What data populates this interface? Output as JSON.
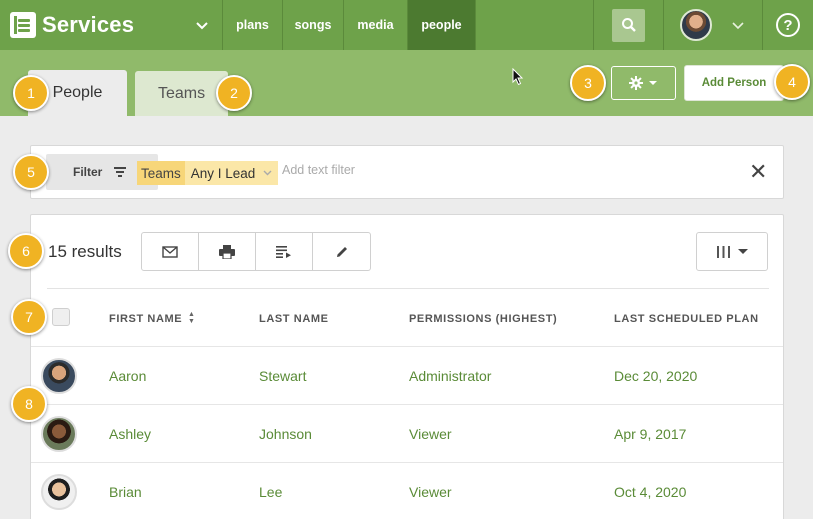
{
  "app": {
    "title": "Services",
    "nav": [
      "plans",
      "songs",
      "media",
      "people"
    ],
    "active_nav": "people",
    "help_label": "?"
  },
  "tabs": [
    {
      "label": "People",
      "active": true
    },
    {
      "label": "Teams",
      "active": false
    }
  ],
  "actions": {
    "add_person_label": "Add Person"
  },
  "filter": {
    "button_label": "Filter",
    "chip_key": "Teams",
    "chip_value": "Any I Lead",
    "text_placeholder": "Add text filter",
    "clear_label": "✕"
  },
  "results": {
    "count_label": "15 results"
  },
  "table": {
    "headers": [
      "FIRST NAME",
      "LAST NAME",
      "PERMISSIONS (HIGHEST)",
      "LAST SCHEDULED PLAN"
    ],
    "rows": [
      {
        "first": "Aaron",
        "last": "Stewart",
        "permission": "Administrator",
        "last_plan": "Dec 20, 2020"
      },
      {
        "first": "Ashley",
        "last": "Johnson",
        "permission": "Viewer",
        "last_plan": "Apr 9, 2017"
      },
      {
        "first": "Brian",
        "last": "Lee",
        "permission": "Viewer",
        "last_plan": "Oct 4, 2020"
      }
    ]
  },
  "callouts": [
    "1",
    "2",
    "3",
    "4",
    "5",
    "6",
    "7",
    "8"
  ],
  "colors": {
    "nav_green": "#6ea24a",
    "nav_active": "#4c7a30",
    "subbar_green": "#90ba6a",
    "link_green": "#5a8b37",
    "callout_gold": "#f0b323",
    "chip_key": "#f7d679",
    "chip_value": "#fbe7a8"
  }
}
